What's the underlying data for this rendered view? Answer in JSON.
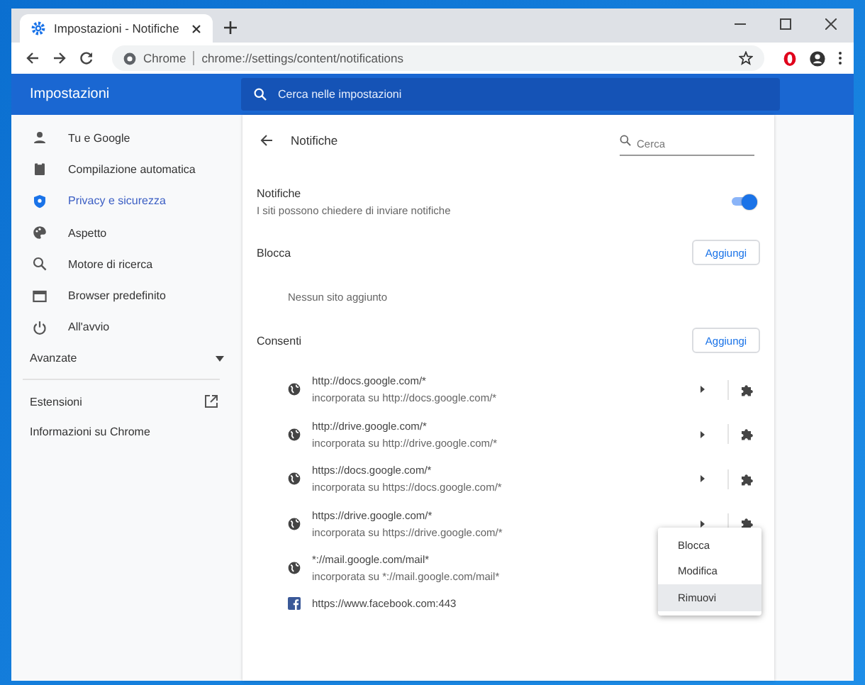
{
  "window": {
    "tab_title": "Impostazioni - Notifiche"
  },
  "toolbar": {
    "site_label": "Chrome",
    "url": "chrome://settings/content/notifications"
  },
  "header": {
    "title": "Impostazioni",
    "search_placeholder": "Cerca nelle impostazioni"
  },
  "sidebar": {
    "items": [
      {
        "label": "Tu e Google",
        "selected": false
      },
      {
        "label": "Compilazione automatica",
        "selected": false
      },
      {
        "label": "Privacy e sicurezza",
        "selected": true
      },
      {
        "label": "Aspetto",
        "selected": false
      },
      {
        "label": "Motore di ricerca",
        "selected": false
      },
      {
        "label": "Browser predefinito",
        "selected": false
      },
      {
        "label": "All'avvio",
        "selected": false
      }
    ],
    "advanced": {
      "label": "Avanzate",
      "expanded": false
    },
    "extensions": "Estensioni",
    "about": "Informazioni su Chrome"
  },
  "page": {
    "title": "Notifiche",
    "search_placeholder": "Cerca",
    "setting": {
      "title": "Notifiche",
      "description": "I siti possono chiedere di inviare notifiche",
      "on": true
    },
    "block": {
      "title": "Blocca",
      "button": "Aggiungi",
      "empty": "Nessun sito aggiunto"
    },
    "allow": {
      "title": "Consenti",
      "button": "Aggiungi",
      "rows": [
        {
          "kind": "globe",
          "site": "http://docs.google.com/*",
          "embedded": "incorporata su http://docs.google.com/*",
          "actions": true
        },
        {
          "kind": "globe",
          "site": "http://drive.google.com/*",
          "embedded": "incorporata su http://drive.google.com/*",
          "actions": true
        },
        {
          "kind": "globe",
          "site": "https://docs.google.com/*",
          "embedded": "incorporata su https://docs.google.com/*",
          "actions": true
        },
        {
          "kind": "globe",
          "site": "https://drive.google.com/*",
          "embedded": "incorporata su https://drive.google.com/*",
          "actions": true
        },
        {
          "kind": "globe",
          "site": "*://mail.google.com/mail*",
          "embedded": "incorporata su *://mail.google.com/mail*"
        },
        {
          "kind": "facebook",
          "site": "https://www.facebook.com:443"
        }
      ]
    }
  },
  "context_menu": {
    "items": [
      {
        "label": "Blocca",
        "highlighted": false
      },
      {
        "label": "Modifica",
        "highlighted": false
      },
      {
        "label": "Rimuovi",
        "highlighted": true
      }
    ]
  }
}
